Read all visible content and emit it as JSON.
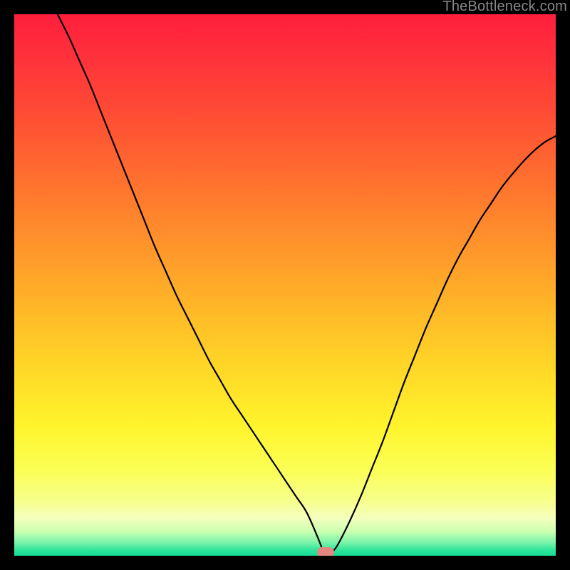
{
  "watermark": "TheBottleneck.com",
  "gradient_stops": [
    {
      "offset": 0.0,
      "color": "#FF1E3C"
    },
    {
      "offset": 0.07,
      "color": "#FF2F3B"
    },
    {
      "offset": 0.18,
      "color": "#FF4B35"
    },
    {
      "offset": 0.3,
      "color": "#FF6E2F"
    },
    {
      "offset": 0.42,
      "color": "#FF922B"
    },
    {
      "offset": 0.55,
      "color": "#FFB927"
    },
    {
      "offset": 0.66,
      "color": "#FFD927"
    },
    {
      "offset": 0.76,
      "color": "#FFF42C"
    },
    {
      "offset": 0.84,
      "color": "#FBFF54"
    },
    {
      "offset": 0.9,
      "color": "#F7FF8E"
    },
    {
      "offset": 0.93,
      "color": "#F5FFBE"
    },
    {
      "offset": 0.955,
      "color": "#CBFFB0"
    },
    {
      "offset": 0.975,
      "color": "#7CF4AA"
    },
    {
      "offset": 0.99,
      "color": "#2CE59B"
    },
    {
      "offset": 1.0,
      "color": "#17DB93"
    }
  ],
  "chart_data": {
    "type": "line",
    "title": "",
    "xlabel": "",
    "ylabel": "",
    "xlim": [
      0,
      100
    ],
    "ylim": [
      0,
      100
    ],
    "grid": false,
    "min_marker_x": 57.5,
    "min_marker_color": "#E48582",
    "x": [
      8,
      10,
      12,
      14,
      16,
      18,
      20,
      22,
      24,
      26,
      28,
      30,
      32,
      34,
      36,
      38,
      40,
      42,
      44,
      46,
      48,
      50,
      52,
      54,
      56,
      57,
      57.5,
      58,
      59,
      60,
      62,
      64,
      66,
      68,
      70,
      72,
      74,
      76,
      78,
      80,
      82,
      84,
      86,
      88,
      90,
      92,
      94,
      96,
      98,
      100
    ],
    "values": [
      100.0,
      96.0,
      91.5,
      87.0,
      82.0,
      77.0,
      72.0,
      67.0,
      62.0,
      57.0,
      52.5,
      48.0,
      44.0,
      40.0,
      36.0,
      32.5,
      29.0,
      26.0,
      23.0,
      20.0,
      17.0,
      14.0,
      11.0,
      8.0,
      3.5,
      1.0,
      0.3,
      0.3,
      1.0,
      2.5,
      6.5,
      11.0,
      16.0,
      21.0,
      26.5,
      32.0,
      37.0,
      42.0,
      46.5,
      51.0,
      55.0,
      58.5,
      62.0,
      65.0,
      68.0,
      70.5,
      72.8,
      74.8,
      76.4,
      77.5
    ]
  }
}
